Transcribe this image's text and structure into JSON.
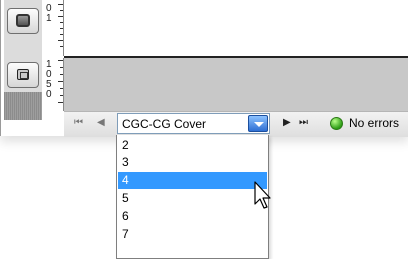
{
  "ruler_top": {
    "labels": [
      "0",
      "1"
    ]
  },
  "ruler_bottom": {
    "labels": [
      "1",
      "0",
      "5",
      "0"
    ]
  },
  "pagination": {
    "first_symbol": "⏮",
    "prev_symbol": "◀",
    "next_symbol": "▶",
    "last_symbol": "⏭",
    "selected_page": "CGC-CG Cover"
  },
  "status": {
    "text": "No errors",
    "color": "#2e9d16"
  },
  "dropdown": {
    "options": [
      "2",
      "3",
      "4",
      "5",
      "6",
      "7"
    ],
    "highlighted_index": 2,
    "highlight_color": "#3399ff"
  },
  "icons": [
    "frame-tool-icon",
    "image-tool-icon",
    "dropdown-chevron-icon",
    "mouse-pointer-icon"
  ]
}
